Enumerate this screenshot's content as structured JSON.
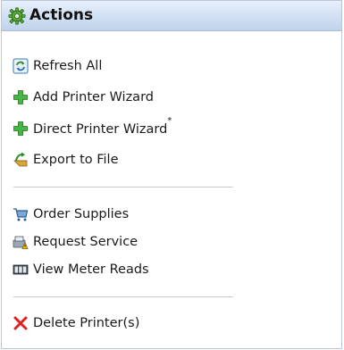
{
  "header": {
    "title": "Actions",
    "icon": "gear-icon"
  },
  "groups": [
    {
      "items": [
        {
          "label": "Refresh All",
          "icon": "refresh-icon"
        },
        {
          "label": "Add Printer Wizard",
          "icon": "plus-icon"
        },
        {
          "label": "Direct Printer Wizard",
          "suffix": "*",
          "icon": "plus-icon"
        },
        {
          "label": "Export to File",
          "icon": "export-icon"
        }
      ]
    },
    {
      "items": [
        {
          "label": "Order Supplies",
          "icon": "cart-icon"
        },
        {
          "label": "Request Service",
          "icon": "service-icon"
        },
        {
          "label": "View Meter Reads",
          "icon": "meter-icon"
        }
      ]
    },
    {
      "items": [
        {
          "label": "Delete Printer(s)",
          "icon": "delete-icon"
        }
      ]
    }
  ],
  "colors": {
    "header_start": "#e8f0fb",
    "header_end": "#c0d3ec",
    "plus_green": "#3aa83a",
    "delete_red": "#e02020"
  }
}
